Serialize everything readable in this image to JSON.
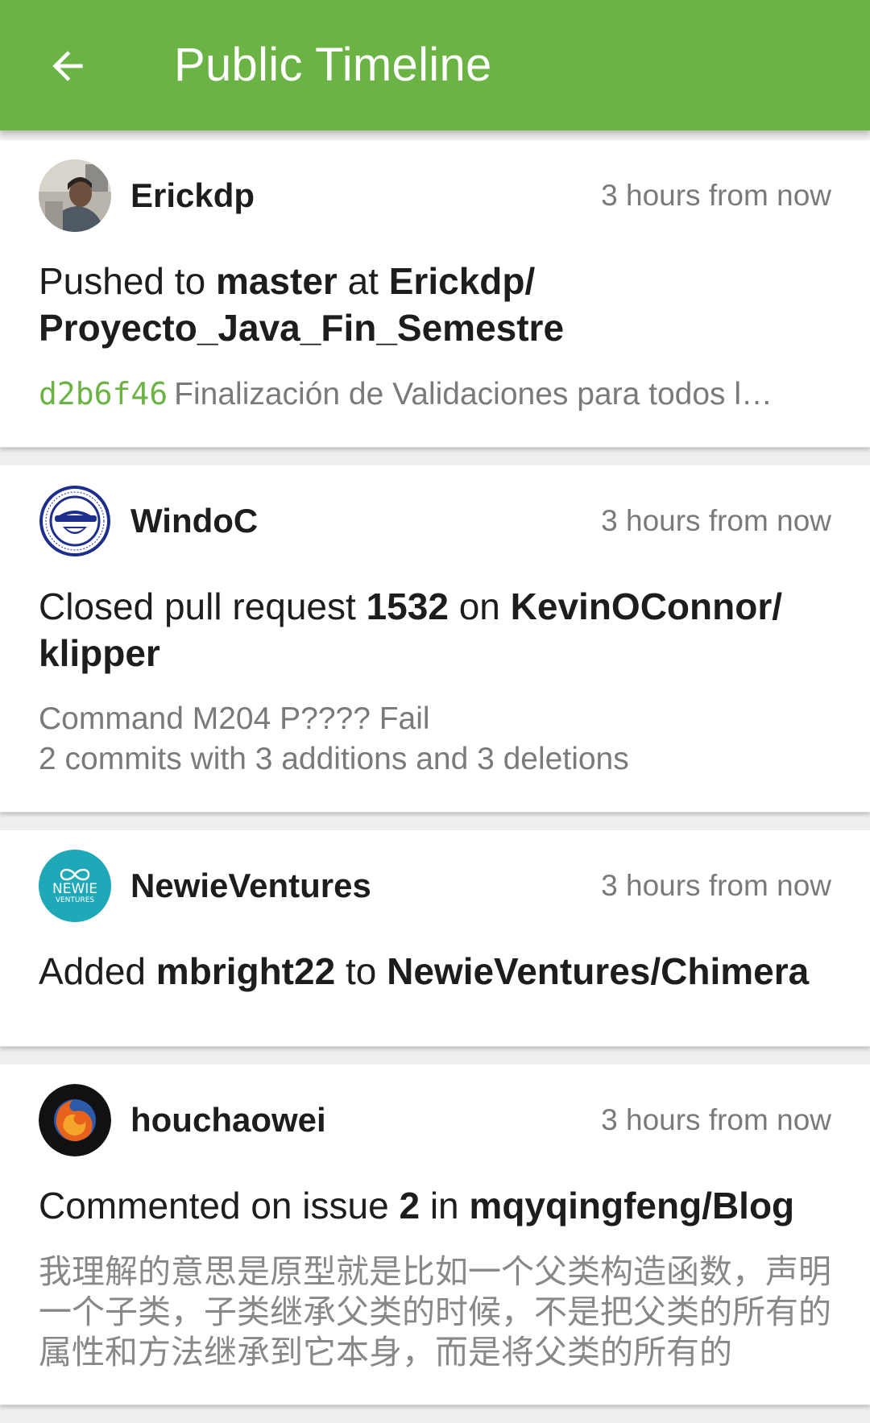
{
  "app_bar": {
    "title": "Public Timeline",
    "back_icon": "arrow-left-icon",
    "color": "#6ab344"
  },
  "feed": [
    {
      "user": "Erickdp",
      "time": "3 hours from now",
      "action": "Pushed to ",
      "ref": "master",
      "middle": " at ",
      "repo": "Erickdp/\nProyecto_Java_Fin_Semestre",
      "commit_sha": "d2b6f46",
      "commit_message": "Finalización de Validaciones para todos l…"
    },
    {
      "user": "WindoC",
      "time": "3 hours from now",
      "action": "Closed pull request ",
      "ref": "1532",
      "middle": " on ",
      "repo": "KevinOConnor/\nklipper",
      "body_line1": "Command M204 P???? Fail",
      "body_line2": "2 commits with 3 additions and 3 deletions"
    },
    {
      "user": "NewieVentures",
      "time": "3 hours from now",
      "action": "Added ",
      "ref": "mbright22",
      "middle": " to ",
      "repo": "NewieVentures/Chimera",
      "avatar_logo_line1": "NEWIE",
      "avatar_logo_line2": "VENTURES"
    },
    {
      "user": "houchaowei",
      "time": "3 hours from now",
      "action": "Commented on issue ",
      "ref": "2",
      "middle": " in ",
      "repo": "mqyqingfeng/Blog",
      "comment": "我理解的意思是原型就是比如一个父类构造函数，声明一个子类，子类继承父类的时候，不是把父类的所有的属性和方法继承到它本身，而是将父类的所有的"
    }
  ]
}
